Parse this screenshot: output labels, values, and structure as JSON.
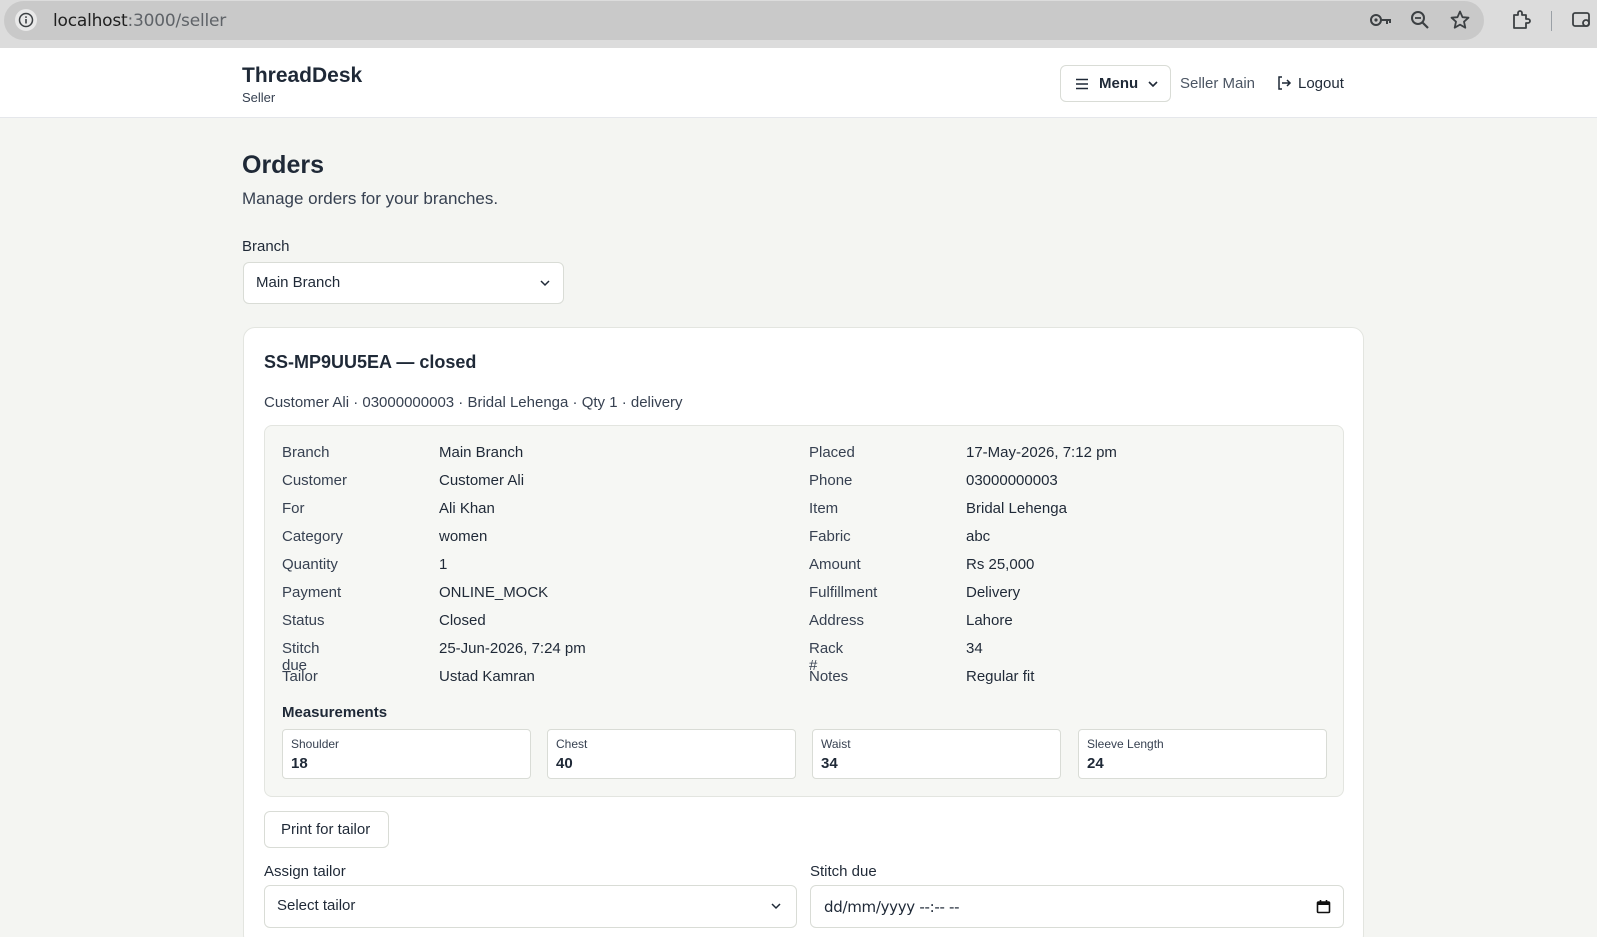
{
  "browser": {
    "url_host": "localhost",
    "url_path": ":3000/seller"
  },
  "header": {
    "brand_title": "ThreadDesk",
    "brand_subtitle": "Seller",
    "menu_label": "Menu",
    "seller_link": "Seller Main",
    "logout_label": "Logout"
  },
  "page": {
    "title": "Orders",
    "subtitle": "Manage orders for your branches.",
    "branch_label": "Branch",
    "branch_value": "Main Branch"
  },
  "order": {
    "title": "SS-MP9UU5EA — closed",
    "summary": "Customer Ali · 03000000003 · Bridal Lehenga · Qty 1 · delivery",
    "details_left": [
      {
        "key": "Branch",
        "value": "Main Branch"
      },
      {
        "key": "Customer",
        "value": "Customer Ali"
      },
      {
        "key": "For",
        "value": "Ali Khan"
      },
      {
        "key": "Category",
        "value": "women"
      },
      {
        "key": "Quantity",
        "value": "1"
      },
      {
        "key": "Payment",
        "value": "ONLINE_MOCK"
      },
      {
        "key": "Status",
        "value": "Closed"
      },
      {
        "key": "Stitch due",
        "value": "25-Jun-2026, 7:24 pm"
      },
      {
        "key": "Tailor",
        "value": "Ustad Kamran"
      }
    ],
    "details_right": [
      {
        "key": "Placed",
        "value": "17-May-2026, 7:12 pm"
      },
      {
        "key": "Phone",
        "value": "03000000003"
      },
      {
        "key": "Item",
        "value": "Bridal Lehenga"
      },
      {
        "key": "Fabric",
        "value": "abc"
      },
      {
        "key": "Amount",
        "value": "Rs 25,000"
      },
      {
        "key": "Fulfillment",
        "value": "Delivery"
      },
      {
        "key": "Address",
        "value": "Lahore"
      },
      {
        "key": "Rack #",
        "value": "34"
      },
      {
        "key": "Notes",
        "value": "Regular fit"
      }
    ],
    "measurements_title": "Measurements",
    "measurements": [
      {
        "key": "Shoulder",
        "value": "18"
      },
      {
        "key": "Chest",
        "value": "40"
      },
      {
        "key": "Waist",
        "value": "34"
      },
      {
        "key": "Sleeve Length",
        "value": "24"
      }
    ],
    "print_label": "Print for tailor",
    "assign_tailor_label": "Assign tailor",
    "assign_tailor_value": "Select tailor",
    "stitch_due_label": "Stitch due",
    "stitch_due_value": "dd/mm/yyyy --:-- --"
  }
}
